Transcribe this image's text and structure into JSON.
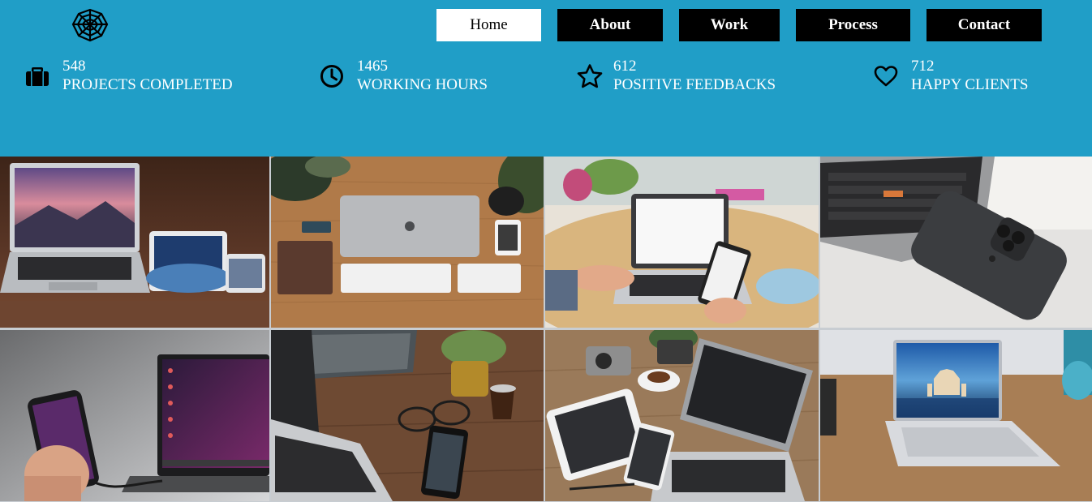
{
  "header": {
    "logo_icon": "spiderweb-icon",
    "nav": [
      {
        "label": "Home",
        "active": true
      },
      {
        "label": "About",
        "active": false
      },
      {
        "label": "Work",
        "active": false
      },
      {
        "label": "Process",
        "active": false
      },
      {
        "label": "Contact",
        "active": false
      }
    ],
    "stats": [
      {
        "icon": "briefcase-icon",
        "value": "548",
        "label": "PROJECTS COMPLETED"
      },
      {
        "icon": "clock-icon",
        "value": "1465",
        "label": "WORKING HOURS"
      },
      {
        "icon": "star-icon",
        "value": "612",
        "label": "POSITIVE FEEDBACKS"
      },
      {
        "icon": "heart-icon",
        "value": "712",
        "label": "HAPPY CLIENTS"
      }
    ]
  },
  "gallery": {
    "photos": [
      {
        "name": "laptop-tablet-phone-on-wood-photo"
      },
      {
        "name": "macbook-flatlay-desk-photo"
      },
      {
        "name": "hands-laptop-phone-meeting-photo"
      },
      {
        "name": "laptop-and-iphone-closeup-photo"
      },
      {
        "name": "hand-phone-connected-laptop-photo"
      },
      {
        "name": "laptop-notebooks-coffee-photo"
      },
      {
        "name": "desk-tablet-laptop-camera-photo"
      },
      {
        "name": "silver-laptop-taj-mahal-wallpaper-photo"
      }
    ]
  },
  "colors": {
    "header_bg": "#209ec7",
    "nav_bg": "#000000",
    "nav_active_bg": "#ffffff"
  }
}
